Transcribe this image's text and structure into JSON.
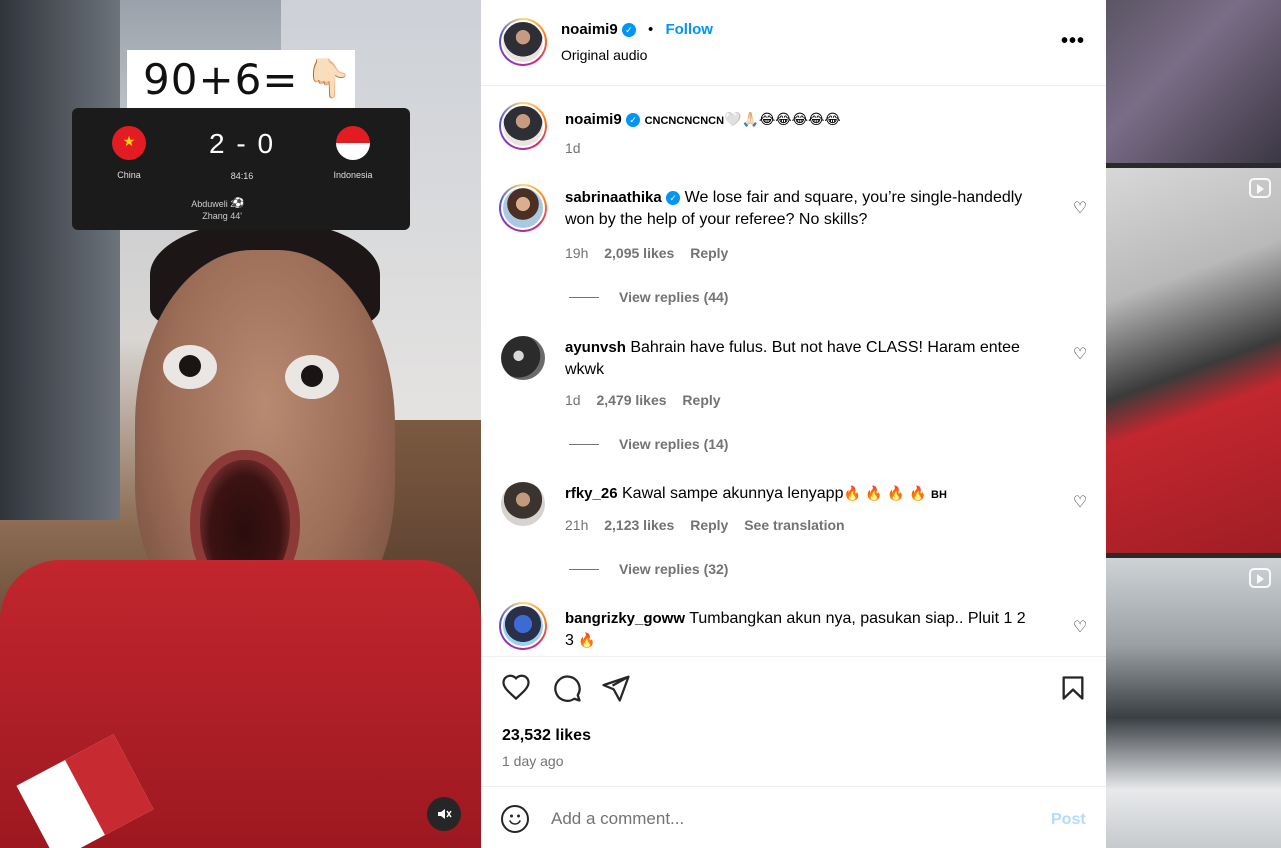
{
  "video": {
    "overlay_formula": "90+6=",
    "overlay_pointer": "👇🏻",
    "scoreboard": {
      "home_team": "China",
      "away_team": "Indonesia",
      "score": "2 - 0",
      "clock": "84:16",
      "scorers": [
        "Abduweli 21'",
        "Zhang 44'"
      ],
      "ball_icon": "⚽"
    },
    "mute_icon": "speaker-muted-icon"
  },
  "post_header": {
    "username": "noaimi9",
    "separator": "•",
    "follow_label": "Follow",
    "audio_label": "Original audio",
    "more_label": "•••"
  },
  "caption": {
    "username": "noaimi9",
    "text": "CNCNCNCNCN",
    "emojis": "🤍🙏🏻😂😂😂😂😂",
    "time": "1d"
  },
  "comments": [
    {
      "username": "sabrinaathika",
      "verified": true,
      "text": "We lose fair and square, you’re single-handedly won by the help of your referee? No skills?",
      "time": "19h",
      "likes": "2,095 likes",
      "reply": "Reply",
      "view_replies": "View replies (44)"
    },
    {
      "username": "ayunvsh",
      "verified": false,
      "text": "Bahrain have fulus. But not have CLASS! Haram entee wkwk",
      "time": "1d",
      "likes": "2,479 likes",
      "reply": "Reply",
      "view_replies": "View replies (14)"
    },
    {
      "username": "rfky_26",
      "verified": false,
      "text": "Kawal sampe akunnya lenyapp",
      "emojis": "🔥 🔥 🔥 🔥",
      "suffix": "BH",
      "time": "21h",
      "likes": "2,123 likes",
      "reply": "Reply",
      "see_translation": "See translation",
      "view_replies": "View replies (32)"
    },
    {
      "username": "bangrizky_goww",
      "verified": false,
      "text": "Tumbangkan akun nya, pasukan siap.. Pluit 1 2 3",
      "emojis": "🔥"
    }
  ],
  "actions": {
    "like_icon": "heart-icon",
    "comment_icon": "comment-icon",
    "share_icon": "share-icon",
    "save_icon": "bookmark-icon",
    "likes_count": "23,532 likes",
    "posted": "1 day ago"
  },
  "add_comment": {
    "emoji_icon": "emoji-icon",
    "placeholder": "Add a comment...",
    "post_label": "Post"
  },
  "colors": {
    "accent": "#0095f6",
    "secondary_text": "#737373",
    "post_disabled": "#b3dbff"
  }
}
